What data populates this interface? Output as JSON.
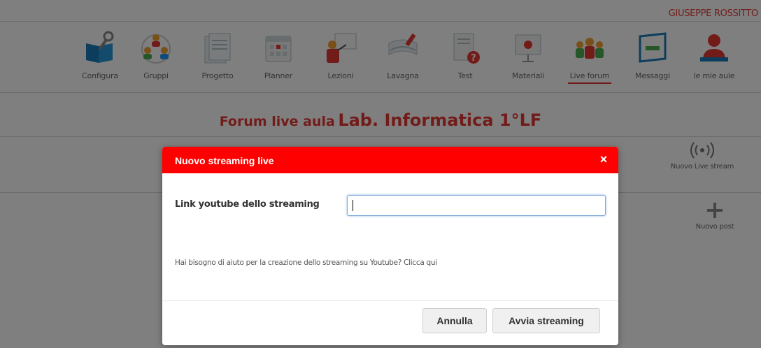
{
  "user": {
    "name": "GIUSEPPE ROSSITTO"
  },
  "nav": {
    "items": [
      {
        "label": "Configura",
        "icon": "configure-icon"
      },
      {
        "label": "Gruppi",
        "icon": "groups-icon"
      },
      {
        "label": "Progetto",
        "icon": "project-icon"
      },
      {
        "label": "Planner",
        "icon": "planner-icon"
      },
      {
        "label": "Lezioni",
        "icon": "lessons-icon"
      },
      {
        "label": "Lavagna",
        "icon": "whiteboard-icon"
      },
      {
        "label": "Test",
        "icon": "test-icon"
      },
      {
        "label": "Materiali",
        "icon": "materials-icon"
      },
      {
        "label": "Live forum",
        "icon": "live-forum-icon",
        "active": true
      },
      {
        "label": "Messaggi",
        "icon": "messages-icon"
      },
      {
        "label": "le mie aule",
        "icon": "my-classrooms-icon"
      }
    ]
  },
  "page": {
    "title_prefix": "Forum live aula",
    "room_name": "Lab. Informatica 1°LF"
  },
  "side_actions": {
    "new_live_stream": "Nuovo Live stream",
    "new_post": "Nuovo post"
  },
  "modal": {
    "title": "Nuovo streaming live",
    "close_symbol": "×",
    "field_label": "Link youtube dello streaming",
    "field_value": "",
    "help_text": "Hai bisogno di aiuto per la creazione dello streaming su Youtube? Clicca qui",
    "cancel_label": "Annulla",
    "start_label": "Avvia streaming"
  },
  "colors": {
    "accent": "#e53935",
    "modal_header": "#ff0000"
  }
}
